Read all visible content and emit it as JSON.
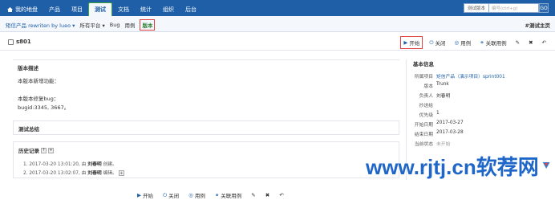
{
  "topnav": {
    "items": [
      {
        "label": "我的地盘",
        "icon": "home-icon"
      },
      {
        "label": "产品"
      },
      {
        "label": "项目"
      },
      {
        "label": "测试",
        "active": true
      },
      {
        "label": "文档"
      },
      {
        "label": "统计"
      },
      {
        "label": "组织"
      },
      {
        "label": "后台"
      }
    ],
    "search": {
      "type": "测试版本",
      "placeholder": "编号(ctrl+g)",
      "go": "GO"
    }
  },
  "subnav": {
    "items": [
      "矩信产品 rewriten by lueo ▾",
      "所有平台 ▾",
      "Bug",
      "用例",
      "版本"
    ],
    "right": "#测试主页"
  },
  "header": {
    "id": "1",
    "title": "s801",
    "actions": [
      "开始",
      "关闭",
      "用例",
      "关联用例"
    ],
    "icons": [
      "edit-icon",
      "delete-icon",
      "back-icon"
    ]
  },
  "description": {
    "heading": "版本描述",
    "lines": [
      "本版本新增功能：",
      "本版本修复bug：",
      "bugid:3345, 3667。"
    ]
  },
  "summary": {
    "heading": "测试总结"
  },
  "history": {
    "heading": "历史记录",
    "entries": [
      {
        "text": "1. 2017-03-20 13:01:20, 由 ",
        "who": "刘春明",
        "action": " 创建。"
      },
      {
        "text": "2. 2017-03-20 13:02:07, 由 ",
        "who": "刘春明",
        "action": " 编辑。"
      }
    ]
  },
  "info": {
    "heading": "基本信息",
    "rows": [
      {
        "k": "所属项目",
        "v": "矩信产品（演示项目）sprint001",
        "link": true
      },
      {
        "k": "版本",
        "v": "Trunk"
      },
      {
        "k": "负责人",
        "v": "刘春明"
      },
      {
        "k": "抄送给",
        "v": ""
      },
      {
        "k": "优先级",
        "v": "1"
      },
      {
        "k": "开始日期",
        "v": "2017-03-27"
      },
      {
        "k": "结束日期",
        "v": "2017-03-28"
      },
      {
        "k": "当前状态",
        "v": "未开始",
        "muted": true
      }
    ]
  },
  "bottom_actions": [
    "开始",
    "关闭",
    "用例",
    "关联用例"
  ],
  "watermark": {
    "text": "www.rjtj.cn软荐网"
  },
  "colors": {
    "nav": "#1e5fa8",
    "accent_green": "#3aa63a",
    "highlight_red": "#e04040"
  }
}
